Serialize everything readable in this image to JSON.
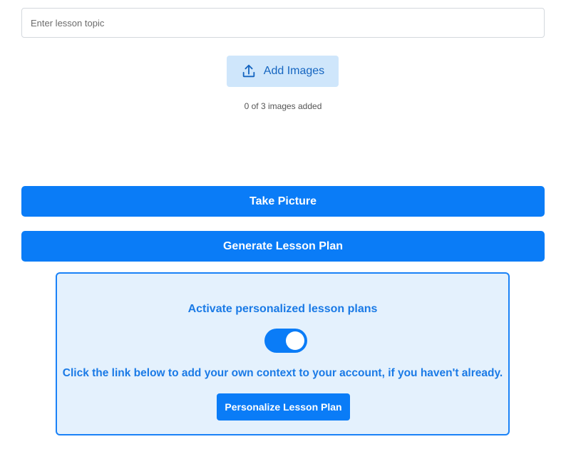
{
  "topic": {
    "placeholder": "Enter lesson topic",
    "value": ""
  },
  "images": {
    "add_label": "Add Images",
    "count_text": "0 of 3 images added",
    "icon": "upload-icon"
  },
  "actions": {
    "take_picture": "Take Picture",
    "generate": "Generate Lesson Plan"
  },
  "personalize": {
    "title": "Activate personalized lesson plans",
    "toggle_on": true,
    "description": "Click the link below to add your own context to your account, if you haven't already.",
    "button_label": "Personalize Lesson Plan"
  },
  "colors": {
    "primary": "#0a7cf7",
    "card_bg": "#e4f1fd",
    "card_border": "#1a82f7",
    "add_images_bg": "#cfe6fb",
    "text_blue": "#1a7ae6"
  }
}
